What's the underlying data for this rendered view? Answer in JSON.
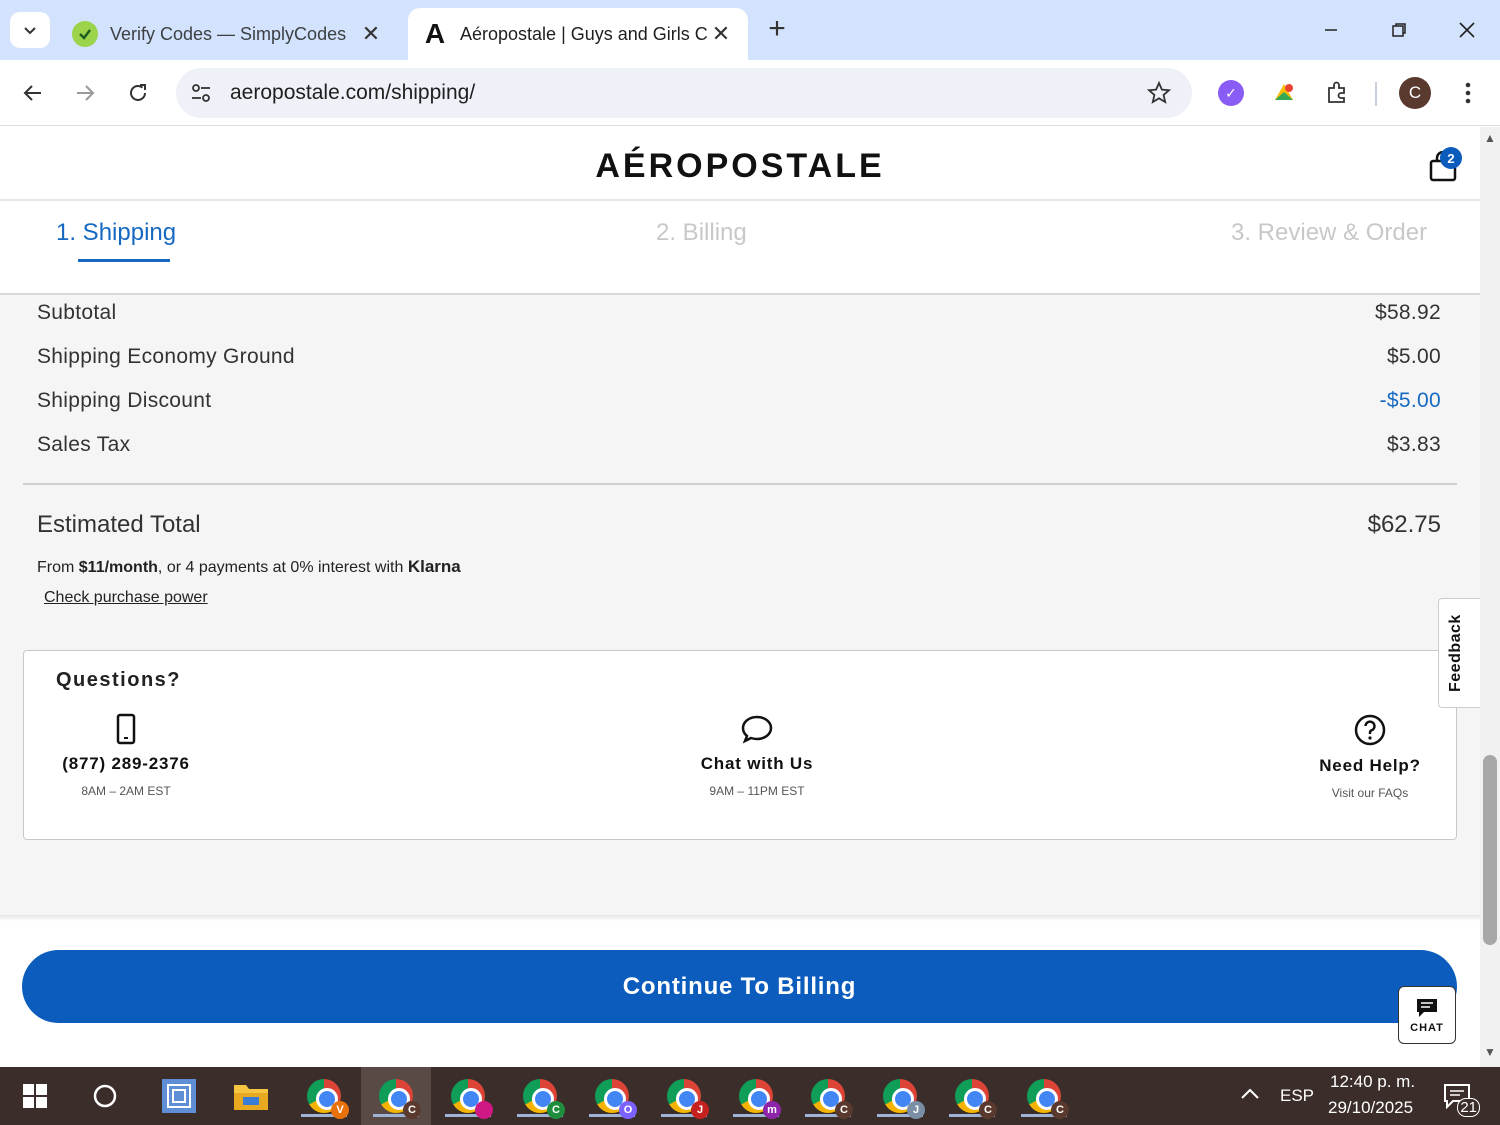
{
  "browser": {
    "tabs": [
      {
        "title": "Verify Codes — SimplyCodes",
        "favicon": "simplycodes-icon",
        "active": false
      },
      {
        "title": "Aéropostale | Guys and Girls Clothing",
        "favicon": "aeropostale-icon",
        "active": true
      }
    ],
    "favicon_letter": "A",
    "url": "aeropostale.com/shipping/",
    "profile_initial": "C"
  },
  "site": {
    "logo": "AÉROPOSTALE",
    "cart_count": "2"
  },
  "steps": [
    {
      "label": "1. Shipping",
      "active": true
    },
    {
      "label": "2. Billing",
      "active": false
    },
    {
      "label": "3. Review & Order",
      "active": false
    }
  ],
  "summary": {
    "lines": [
      {
        "label": "Subtotal",
        "value": "$58.92"
      },
      {
        "label": "Shipping Economy Ground",
        "value": "$5.00"
      },
      {
        "label": "Shipping Discount",
        "value": "-$5.00"
      },
      {
        "label": "Sales Tax",
        "value": "$3.83"
      }
    ],
    "total_label": "Estimated Total",
    "total_value": "$62.75",
    "klarna": {
      "prefix": "From ",
      "amount": "$11/month",
      "middle": ", or 4 payments at 0% interest with ",
      "brand": "Klarna",
      "link": "Check purchase power"
    }
  },
  "questions": {
    "title": "Questions?",
    "phone": {
      "main": "(877) 289-2376",
      "sub": "8AM – 2AM EST"
    },
    "chat": {
      "main": "Chat with Us",
      "sub": "9AM – 11PM EST"
    },
    "help": {
      "main": "Need Help?",
      "sub": "Visit our FAQs"
    }
  },
  "feedback_label": "Feedback",
  "continue_label": "Continue To Billing",
  "chat_widget_label": "CHAT",
  "taskbar": {
    "profiles": [
      "V",
      "C",
      "",
      "C",
      "O",
      "J",
      "m",
      "C",
      "J",
      "C",
      "C"
    ],
    "profile_colors": [
      "#e8710a",
      "#5a3a2e",
      "#d01884",
      "#1e8e3e",
      "#7b61ff",
      "#c5221f",
      "#8e24aa",
      "#5a3a2e",
      "#7a8ea6",
      "#5a3a2e",
      "#5a3a2e"
    ],
    "lang": "ESP",
    "time": "12:40 p. m.",
    "date": "29/10/2025",
    "notifications": "21"
  },
  "colors": {
    "accent": "#0b5cbc",
    "link_blue": "#1669c2"
  }
}
